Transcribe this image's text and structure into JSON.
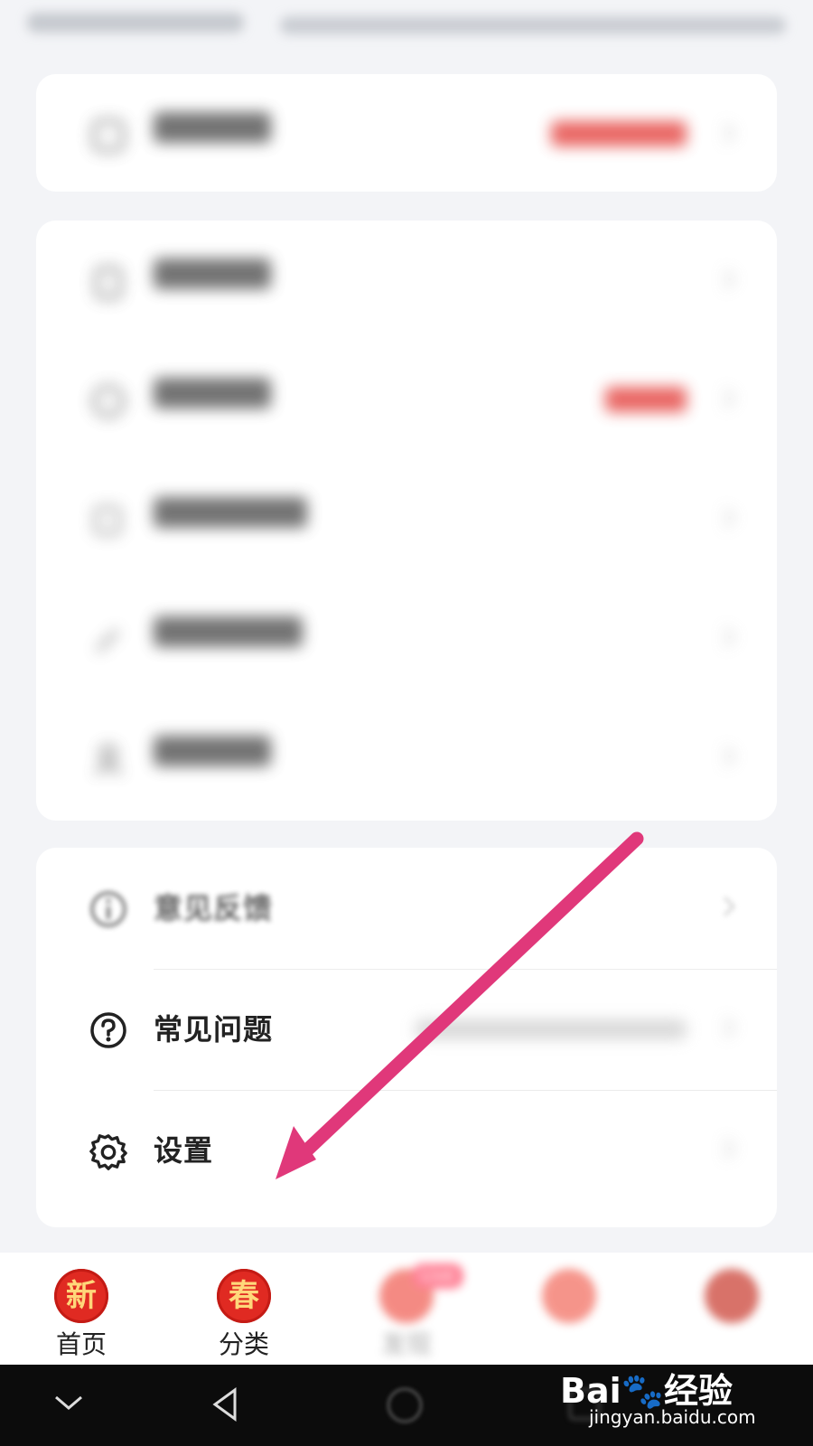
{
  "colors": {
    "accent_red": "#e2332f",
    "arrow": "#e0387a",
    "tab_icon_red": "#e02a22"
  },
  "menu": {
    "group1": [
      {
        "icon": "list-icon",
        "label": "",
        "badge": ""
      }
    ],
    "group2": [
      {
        "icon": "clipboard-icon",
        "label": ""
      },
      {
        "icon": "circle-icon",
        "label": ""
      },
      {
        "icon": "edit-icon",
        "label": ""
      },
      {
        "icon": "pencil-icon",
        "label": ""
      },
      {
        "icon": "user-icon",
        "label": ""
      }
    ],
    "group3": [
      {
        "icon": "info-icon",
        "label": "意见反馈"
      },
      {
        "icon": "question-icon",
        "label": "常见问题"
      },
      {
        "icon": "gear-icon",
        "label": "设置"
      }
    ]
  },
  "tabbar": {
    "tabs": [
      {
        "glyph": "新",
        "label": "首页"
      },
      {
        "glyph": "春",
        "label": "分类"
      },
      {
        "glyph": "",
        "label": "发现",
        "badge": "Live"
      },
      {
        "glyph": "",
        "label": ""
      },
      {
        "glyph": "",
        "label": ""
      }
    ]
  },
  "watermark": {
    "brand_pre": "Bai",
    "brand_post": "经验",
    "url": "jingyan.baidu.com"
  }
}
